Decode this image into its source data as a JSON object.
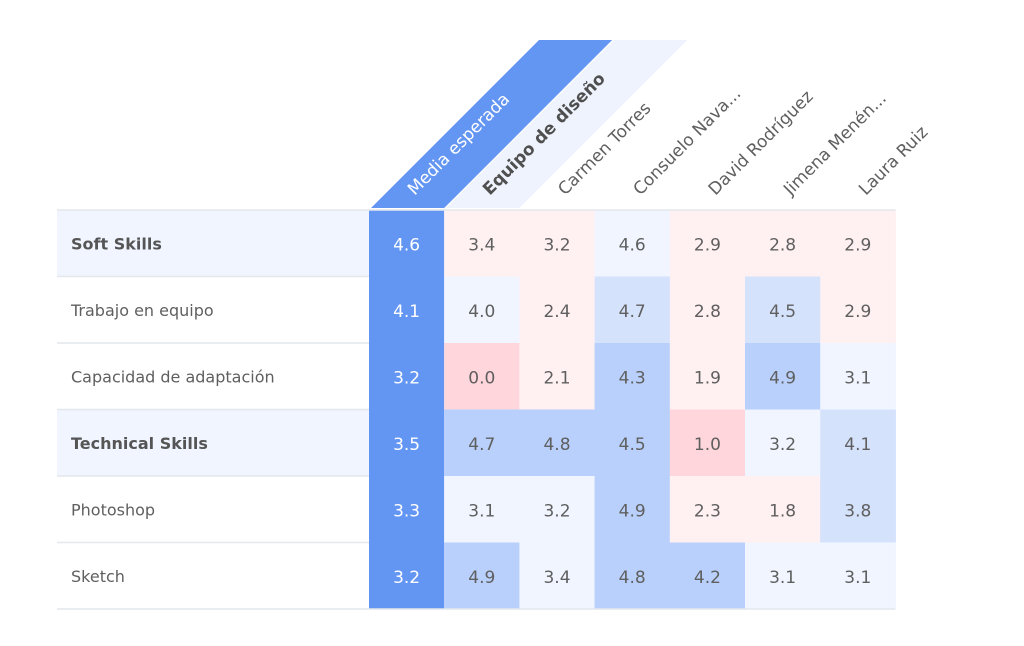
{
  "chart_data": {
    "type": "heatmap",
    "title": "",
    "columns": [
      "Media esperada",
      "Equipo de diseño",
      "Carmen Torres",
      "Consuelo Nava...",
      "David Rodríguez",
      "Jimena Menén...",
      "Laura Ruiz"
    ],
    "highlight_column": "Media esperada",
    "team_column": "Equipo de diseño",
    "rows": [
      {
        "label": "Soft Skills",
        "group": true,
        "values": [
          4.6,
          3.4,
          3.2,
          4.6,
          2.9,
          2.8,
          2.9
        ]
      },
      {
        "label": "Trabajo en equipo",
        "group": false,
        "values": [
          4.1,
          4.0,
          2.4,
          4.7,
          2.8,
          4.5,
          2.9
        ]
      },
      {
        "label": "Capacidad de adaptación",
        "group": false,
        "values": [
          3.2,
          0.0,
          2.1,
          4.3,
          1.9,
          4.9,
          3.1
        ]
      },
      {
        "label": "Technical Skills",
        "group": true,
        "values": [
          3.5,
          4.7,
          4.8,
          4.5,
          1.0,
          3.2,
          4.1
        ]
      },
      {
        "label": "Photoshop",
        "group": false,
        "values": [
          3.3,
          3.1,
          3.2,
          4.9,
          2.3,
          1.8,
          3.8
        ]
      },
      {
        "label": "Sketch",
        "group": false,
        "values": [
          3.2,
          4.9,
          3.4,
          4.8,
          4.2,
          3.1,
          3.1
        ]
      }
    ],
    "value_range": [
      0,
      5
    ],
    "number_format": "0.0"
  },
  "colors": {
    "highlight": "#6395f2",
    "group_row_bg": "#f0f5ff",
    "neutral": "#f0f5ff",
    "above_light": "#d4e2fc",
    "above_strong": "#b8d0fb",
    "below_light": "#fff0f2",
    "below_strong": "#ffd6dc",
    "team_header_bg": "#eef3fd",
    "grid_line": "#e4e7ec"
  }
}
